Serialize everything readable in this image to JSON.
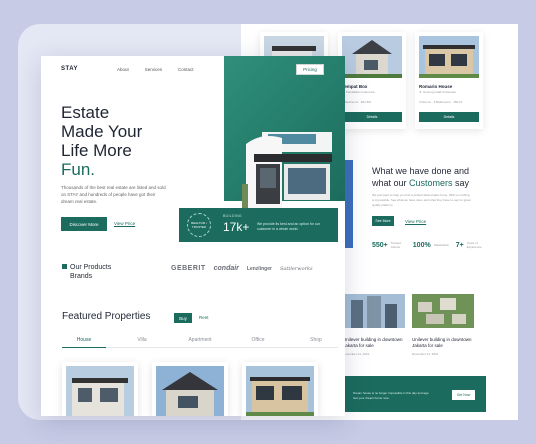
{
  "nav": {
    "logo": "STAY",
    "links": [
      "About",
      "Services",
      "Contact"
    ],
    "pricing": "Pricing"
  },
  "hero": {
    "title_lines": [
      "Estate",
      "Made Your",
      "Life More"
    ],
    "title_accent": "Fun.",
    "description": "Thousands of the best real estate are listed and sold on STAY and hundreds of people have got their dream real estate.",
    "discover_button": "Discover More",
    "view_price": "View Price"
  },
  "stat": {
    "badge": "REALTOR • TRUSTED",
    "label": "BUILDING",
    "value": "17k+",
    "text": "We provide its best and an option for our customer in a whole world."
  },
  "products": {
    "heading_line1": "Our Products",
    "heading_line2": "Brands",
    "brands": [
      "GEBERIT",
      "condair",
      "Lenzlinger",
      "Sattlerworks"
    ]
  },
  "featured": {
    "title": "Featured Properties",
    "buy": "Buy",
    "rent": "Rent",
    "tabs": [
      "House",
      "Villa",
      "Apartment",
      "Office",
      "Shop"
    ],
    "active_tab": "House"
  },
  "listings": [
    {
      "name": "Tempat Box",
      "address": "Jl. Pendidikan Indonesia",
      "meta": "4 Bedrooms · $41.5M",
      "button": "Details"
    },
    {
      "name": "Romario House",
      "address": "Jl. Gunung Indah Indonesia",
      "meta": "4 Rooms · 6 Bathrooms · 450 FT",
      "button": "Details"
    }
  ],
  "about": {
    "line1": "What we have done and",
    "line2_prefix": "what our ",
    "line2_accent": "Customers",
    "line2_suffix": " say",
    "description": "We just want to help you find a perfect Real estate home. With us nothing is impossible. See what we have done and what they have to say for great quality platform.",
    "see_more": "See More",
    "view_price": "View Price",
    "stats": [
      {
        "value": "550+",
        "label": "Trusted Clients"
      },
      {
        "value": "100%",
        "label": "Satisfaction"
      },
      {
        "value": "7+",
        "label": "Years of Experience"
      }
    ]
  },
  "news": [
    {
      "title": "Unilever building in downtown Jakarta for sale",
      "date": "December 21, 2021"
    },
    {
      "title": "Unilever building in downtown Jakarta for sale",
      "date": "December 21, 2021"
    }
  ],
  "newsletter": {
    "text": "Dream house is no longer impossible in this day and age. Get your dream home now.",
    "button": "Get Now"
  },
  "colors": {
    "accent": "#1b6b5e",
    "background": "#c7cbe6"
  }
}
